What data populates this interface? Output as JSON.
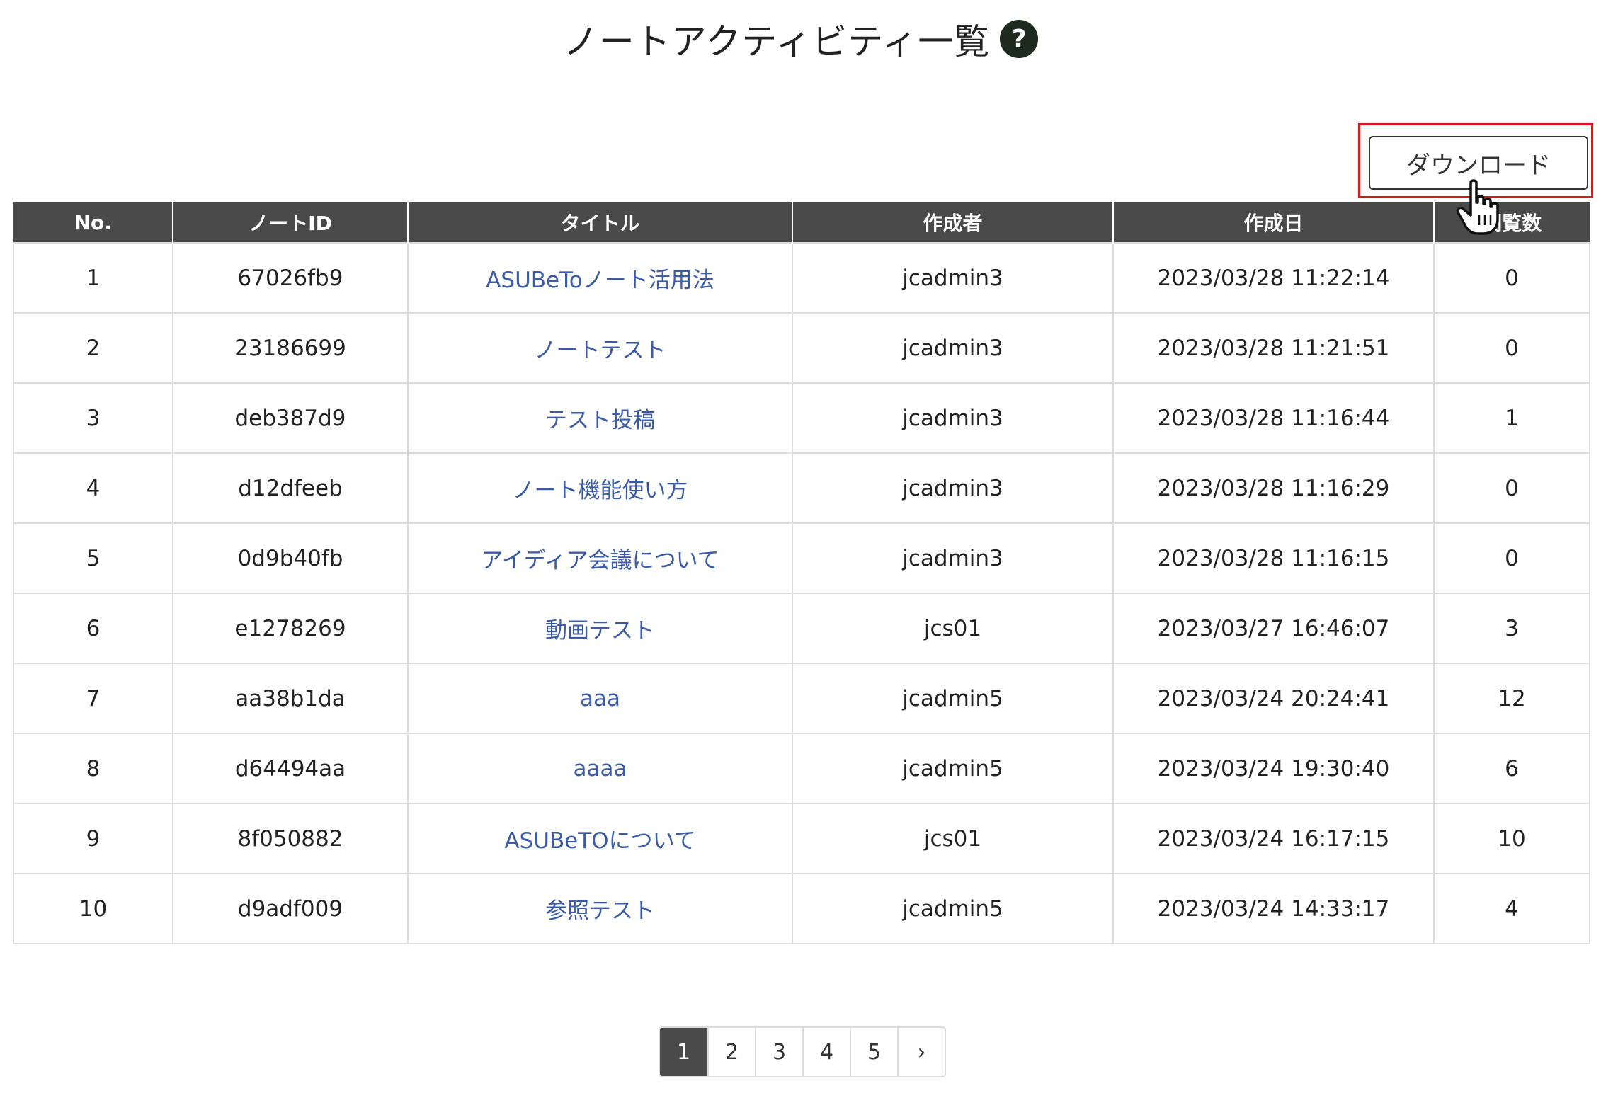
{
  "header": {
    "title": "ノートアクティビティ一覧",
    "help_icon": "?"
  },
  "toolbar": {
    "download_label": "ダウンロード"
  },
  "table": {
    "columns": [
      "No.",
      "ノートID",
      "タイトル",
      "作成者",
      "作成日",
      "閲覧数"
    ],
    "rows": [
      {
        "no": "1",
        "note_id": "67026fb9",
        "title": "ASUBeToノート活用法",
        "author": "jcadmin3",
        "created": "2023/03/28 11:22:14",
        "views": "0"
      },
      {
        "no": "2",
        "note_id": "23186699",
        "title": "ノートテスト",
        "author": "jcadmin3",
        "created": "2023/03/28 11:21:51",
        "views": "0"
      },
      {
        "no": "3",
        "note_id": "deb387d9",
        "title": "テスト投稿",
        "author": "jcadmin3",
        "created": "2023/03/28 11:16:44",
        "views": "1"
      },
      {
        "no": "4",
        "note_id": "d12dfeeb",
        "title": "ノート機能使い方",
        "author": "jcadmin3",
        "created": "2023/03/28 11:16:29",
        "views": "0"
      },
      {
        "no": "5",
        "note_id": "0d9b40fb",
        "title": "アイディア会議について",
        "author": "jcadmin3",
        "created": "2023/03/28 11:16:15",
        "views": "0"
      },
      {
        "no": "6",
        "note_id": "e1278269",
        "title": "動画テスト",
        "author": "jcs01",
        "created": "2023/03/27 16:46:07",
        "views": "3"
      },
      {
        "no": "7",
        "note_id": "aa38b1da",
        "title": "aaa",
        "author": "jcadmin5",
        "created": "2023/03/24 20:24:41",
        "views": "12"
      },
      {
        "no": "8",
        "note_id": "d64494aa",
        "title": "aaaa",
        "author": "jcadmin5",
        "created": "2023/03/24 19:30:40",
        "views": "6"
      },
      {
        "no": "9",
        "note_id": "8f050882",
        "title": "ASUBeTOについて",
        "author": "jcs01",
        "created": "2023/03/24 16:17:15",
        "views": "10"
      },
      {
        "no": "10",
        "note_id": "d9adf009",
        "title": "参照テスト",
        "author": "jcadmin5",
        "created": "2023/03/24 14:33:17",
        "views": "4"
      }
    ]
  },
  "pagination": {
    "pages": [
      "1",
      "2",
      "3",
      "4",
      "5"
    ],
    "next": "›",
    "active": "1"
  },
  "icons": {
    "cursor": "hand-pointer-icon"
  },
  "colors": {
    "header_bg": "#4a4a4a",
    "link": "#3b5ba8",
    "highlight": "#e0161b"
  }
}
